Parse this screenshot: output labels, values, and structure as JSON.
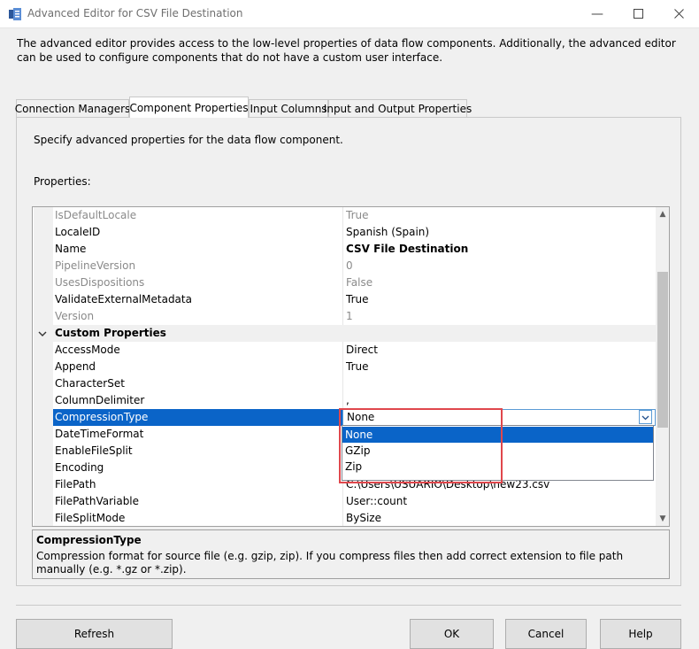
{
  "window": {
    "title": "Advanced Editor for CSV File Destination",
    "description": "The advanced editor provides access to the low-level properties of data flow components. Additionally, the advanced editor can be used to configure components that do not have a custom user interface."
  },
  "tabs": [
    {
      "label": "Connection Managers",
      "active": false
    },
    {
      "label": "Component Properties",
      "active": true
    },
    {
      "label": "Input Columns",
      "active": false
    },
    {
      "label": "Input and Output Properties",
      "active": false
    }
  ],
  "panel": {
    "instruction": "Specify advanced properties for the data flow component.",
    "properties_label": "Properties:"
  },
  "grid": {
    "rows": [
      {
        "name": "IsDefaultLocale",
        "value": "True",
        "disabled": true
      },
      {
        "name": "LocaleID",
        "value": "Spanish (Spain)",
        "disabled": false
      },
      {
        "name": "Name",
        "value": "CSV File Destination",
        "disabled": false,
        "bold": true
      },
      {
        "name": "PipelineVersion",
        "value": "0",
        "disabled": true
      },
      {
        "name": "UsesDispositions",
        "value": "False",
        "disabled": true
      },
      {
        "name": "ValidateExternalMetadata",
        "value": "True",
        "disabled": false
      },
      {
        "name": "Version",
        "value": "1",
        "disabled": true
      }
    ],
    "category": {
      "label": "Custom Properties",
      "expanded": true
    },
    "custom_rows": [
      {
        "name": "AccessMode",
        "value": "Direct"
      },
      {
        "name": "Append",
        "value": "True"
      },
      {
        "name": "CharacterSet",
        "value": ""
      },
      {
        "name": "ColumnDelimiter",
        "value": ","
      },
      {
        "name": "CompressionType",
        "value": "None",
        "selected": true
      },
      {
        "name": "DateTimeFormat",
        "value": ""
      },
      {
        "name": "EnableFileSplit",
        "value": ""
      },
      {
        "name": "Encoding",
        "value": ""
      },
      {
        "name": "FilePath",
        "value": "C:\\Users\\USUARIO\\Desktop\\new23.csv"
      },
      {
        "name": "FilePathVariable",
        "value": "User::count"
      },
      {
        "name": "FileSplitMode",
        "value": "BySize"
      }
    ]
  },
  "dropdown": {
    "options": [
      "None",
      "GZip",
      "Zip"
    ],
    "highlighted": "None"
  },
  "help": {
    "title": "CompressionType",
    "description": "Compression format for source file (e.g. gzip, zip). If you compress files then add correct extension to file path manually (e.g. *.gz or *.zip)."
  },
  "buttons": {
    "refresh": "Refresh",
    "ok": "OK",
    "cancel": "Cancel",
    "help": "Help"
  },
  "colors": {
    "selection": "#0a64c8",
    "highlight_box": "#e0474c"
  }
}
